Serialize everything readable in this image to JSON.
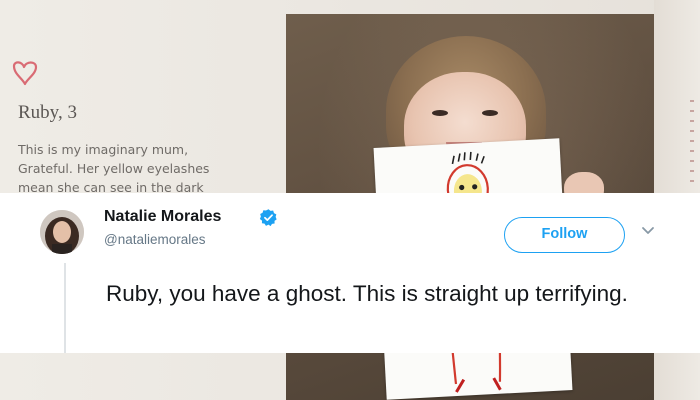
{
  "magazine": {
    "title": "Ruby, 3",
    "body_lines": [
      "This is my imaginary mum,",
      "Grateful. Her yellow eyelashes",
      "mean she can see in the dark"
    ],
    "accent_color": "#d96b74"
  },
  "tweet": {
    "author_name": "Natalie Morales",
    "author_handle": "@nataliemorales",
    "follow_label": "Follow",
    "text": "Ruby, you have a ghost. This is straight up terrifying.",
    "verified": true,
    "brand_color": "#1da1f2"
  },
  "icons": {
    "heart": "heart-icon",
    "verified": "verified-badge-icon",
    "more": "chevron-down-icon"
  }
}
